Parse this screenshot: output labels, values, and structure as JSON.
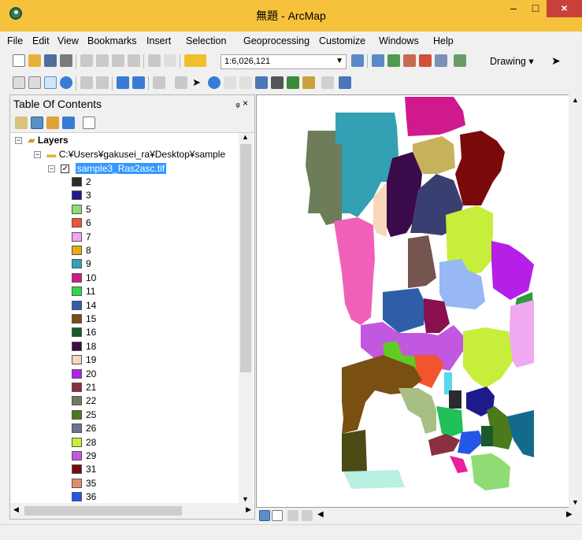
{
  "window": {
    "title": "無題 - ArcMap",
    "controls": {
      "minimize": "–",
      "maximize": "□",
      "close": "×"
    }
  },
  "menu": [
    "File",
    "Edit",
    "View",
    "Bookmarks",
    "Insert",
    "Selection",
    "Geoprocessing",
    "Customize",
    "Windows",
    "Help"
  ],
  "toolbar": {
    "scale": "1:6,026,121",
    "drawing_label": "Drawing ▾"
  },
  "toc": {
    "title": "Table Of Contents",
    "pin": "ᵩ ×",
    "root": "Layers",
    "folder": "C:¥Users¥gakusei_ra¥Desktop¥sample",
    "layer": "sample3_Ras2asc.tif",
    "legend": [
      {
        "label": "2",
        "color": "#2b2b2b"
      },
      {
        "label": "3",
        "color": "#1f1a8c"
      },
      {
        "label": "5",
        "color": "#8fdc74"
      },
      {
        "label": "6",
        "color": "#f2542d"
      },
      {
        "label": "7",
        "color": "#f2a4f0"
      },
      {
        "label": "8",
        "color": "#e8ad0c"
      },
      {
        "label": "9",
        "color": "#34a0b3"
      },
      {
        "label": "10",
        "color": "#d1198e"
      },
      {
        "label": "11",
        "color": "#2ed84a"
      },
      {
        "label": "14",
        "color": "#2f5ea8"
      },
      {
        "label": "15",
        "color": "#7a4f12"
      },
      {
        "label": "16",
        "color": "#1a5a2a"
      },
      {
        "label": "18",
        "color": "#3b0a4a"
      },
      {
        "label": "19",
        "color": "#f7d7bc"
      },
      {
        "label": "20",
        "color": "#b61fe8"
      },
      {
        "label": "21",
        "color": "#8a2f42"
      },
      {
        "label": "22",
        "color": "#6d7d5a"
      },
      {
        "label": "25",
        "color": "#4a7a1c"
      },
      {
        "label": "26",
        "color": "#6f6f8f"
      },
      {
        "label": "28",
        "color": "#c7ee3a"
      },
      {
        "label": "29",
        "color": "#c257e0"
      },
      {
        "label": "31",
        "color": "#7a0a0a"
      },
      {
        "label": "35",
        "color": "#e28d6d"
      },
      {
        "label": "36",
        "color": "#2457e8"
      }
    ]
  },
  "map_regions": [
    {
      "name": "region-22",
      "color": "#6d7d5a"
    },
    {
      "name": "region-9",
      "color": "#34a0b3"
    },
    {
      "name": "region-10",
      "color": "#d1198e"
    },
    {
      "name": "region-8",
      "color": "#c8b15b"
    },
    {
      "name": "region-31",
      "color": "#7a0a0a"
    },
    {
      "name": "region-18",
      "color": "#3b0a4a"
    },
    {
      "name": "region-19",
      "color": "#f7d7bc"
    },
    {
      "name": "region-26",
      "color": "#3a3f72"
    },
    {
      "name": "region-28",
      "color": "#c7ee3a"
    },
    {
      "name": "region-20",
      "color": "#b61fe8"
    },
    {
      "name": "region-brown",
      "color": "#745550"
    },
    {
      "name": "region-pink",
      "color": "#f060b8"
    },
    {
      "name": "region-lightblue",
      "color": "#97b8f5"
    },
    {
      "name": "region-green",
      "color": "#2f9a3e"
    },
    {
      "name": "region-14",
      "color": "#2f5ea8"
    },
    {
      "name": "region-21",
      "color": "#8a1050"
    },
    {
      "name": "region-lavender",
      "color": "#f0a8f0"
    },
    {
      "name": "region-violet",
      "color": "#c257e0"
    },
    {
      "name": "region-lime",
      "color": "#c7ee3a"
    },
    {
      "name": "region-11",
      "color": "#5ecc22"
    },
    {
      "name": "region-6",
      "color": "#f2542d"
    },
    {
      "name": "region-15",
      "color": "#7a4f12"
    },
    {
      "name": "region-sage",
      "color": "#a7bf85"
    },
    {
      "name": "region-cyan",
      "color": "#56d9e8"
    },
    {
      "name": "region-2",
      "color": "#2b2b2b"
    },
    {
      "name": "region-3",
      "color": "#1f1a8c"
    },
    {
      "name": "region-green2",
      "color": "#21c058"
    },
    {
      "name": "region-36",
      "color": "#2457e8"
    },
    {
      "name": "region-25",
      "color": "#4a7a1c"
    },
    {
      "name": "region-teal",
      "color": "#136a8a"
    },
    {
      "name": "region-olive",
      "color": "#4a4a14"
    },
    {
      "name": "region-mint",
      "color": "#b8f0e2"
    },
    {
      "name": "region-5",
      "color": "#8fdc74"
    },
    {
      "name": "region-magenta2",
      "color": "#e8209a"
    },
    {
      "name": "region-darkred",
      "color": "#8a2f42"
    },
    {
      "name": "region-dkgreen",
      "color": "#1a5a2a"
    }
  ]
}
